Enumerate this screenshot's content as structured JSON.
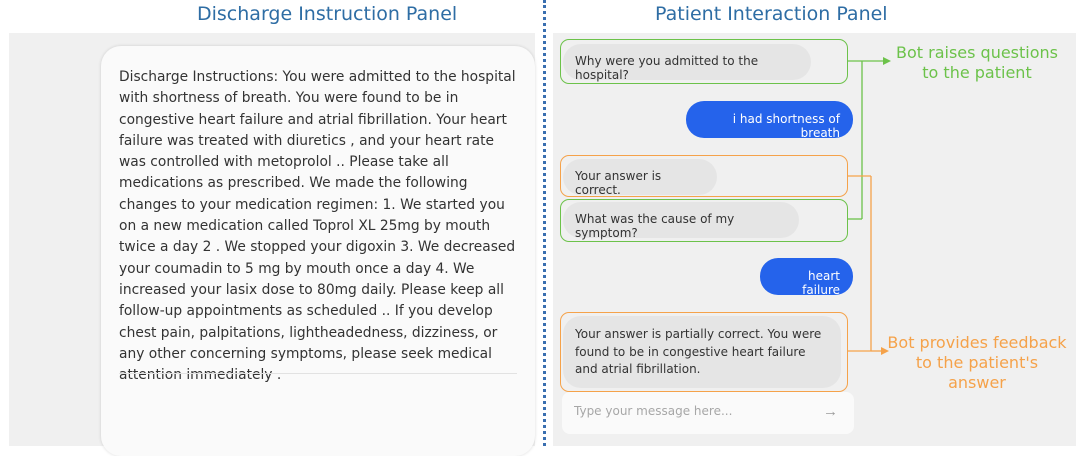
{
  "panels": {
    "left_title": "Discharge Instruction Panel",
    "right_title": "Patient Interaction Panel"
  },
  "discharge": {
    "text": "Discharge Instructions:  You were admitted to the hospital with shortness of breath. You were found to be in congestive heart failure and atrial fibrillation. Your heart failure was treated with diuretics , and your heart rate was controlled with metoprolol .. Please take all medications as prescribed. We made the following changes to your medication regimen: 1. We started you on a new medication called Toprol XL 25mg by mouth twice a day 2 . We stopped your digoxin 3. We decreased your coumadin to 5 mg by mouth once a day 4. We increased your lasix dose to 80mg daily. Please keep all follow-up appointments as scheduled .. If you develop chest pain, palpitations, lightheadedness, dizziness, or any other concerning symptoms, please seek medical attention immediately ."
  },
  "chat": {
    "messages": [
      {
        "sender": "bot",
        "text": "Why were you admitted to the hospital?"
      },
      {
        "sender": "user",
        "text": "i had shortness of breath"
      },
      {
        "sender": "bot",
        "text": "Your answer is correct."
      },
      {
        "sender": "bot",
        "text": "What was the cause of my symptom?"
      },
      {
        "sender": "user",
        "text": "heart failure"
      },
      {
        "sender": "bot",
        "text": "Your answer is partially correct. You were found to be in congestive heart failure and atrial fibrillation."
      }
    ],
    "input_placeholder": "Type your message here...",
    "send_icon": "arrow-right-icon"
  },
  "annotations": {
    "questions": "Bot raises questions to the patient",
    "feedback": "Bot provides feedback to the patient's answer"
  },
  "colors": {
    "question_highlight": "#6cc24a",
    "feedback_highlight": "#f5a24a",
    "user_bubble": "#2563eb",
    "bot_bubble": "#e5e5e5",
    "panel_title": "#2e6da4"
  }
}
